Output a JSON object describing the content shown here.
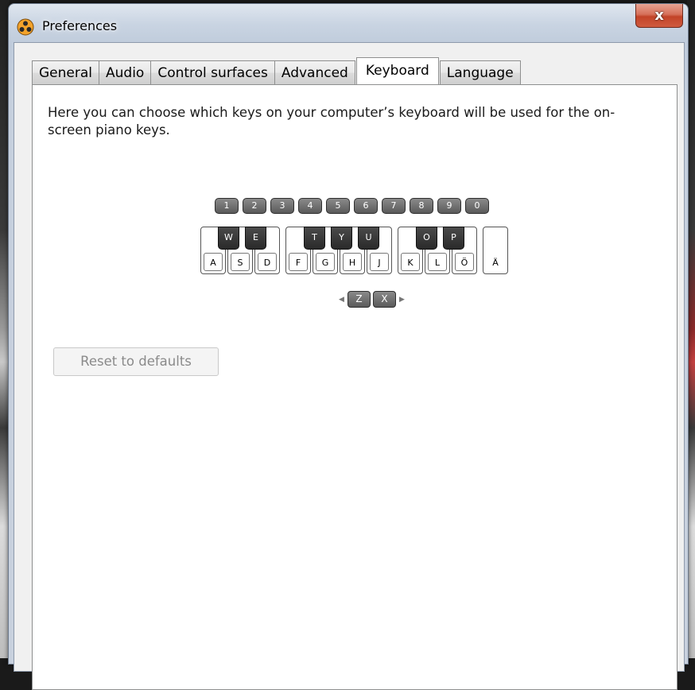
{
  "window": {
    "title": "Preferences",
    "close_label": "x"
  },
  "tabs": [
    {
      "label": "General",
      "active": false
    },
    {
      "label": "Audio",
      "active": false
    },
    {
      "label": "Control surfaces",
      "active": false
    },
    {
      "label": "Advanced",
      "active": false
    },
    {
      "label": "Keyboard",
      "active": true
    },
    {
      "label": "Language",
      "active": false
    }
  ],
  "keyboard": {
    "description": "Here you can choose which keys on your computer’s keyboard will be used for the on-screen piano keys.",
    "number_keys": [
      "1",
      "2",
      "3",
      "4",
      "5",
      "6",
      "7",
      "8",
      "9",
      "0"
    ],
    "white_keys": [
      "A",
      "S",
      "D",
      "F",
      "G",
      "H",
      "J",
      "K",
      "L",
      "Ö",
      "Ä"
    ],
    "black_keys": [
      "W",
      "E",
      "T",
      "Y",
      "U",
      "O",
      "P"
    ],
    "octave_down_key": "Z",
    "octave_up_key": "X",
    "reset_label": "Reset to defaults"
  }
}
